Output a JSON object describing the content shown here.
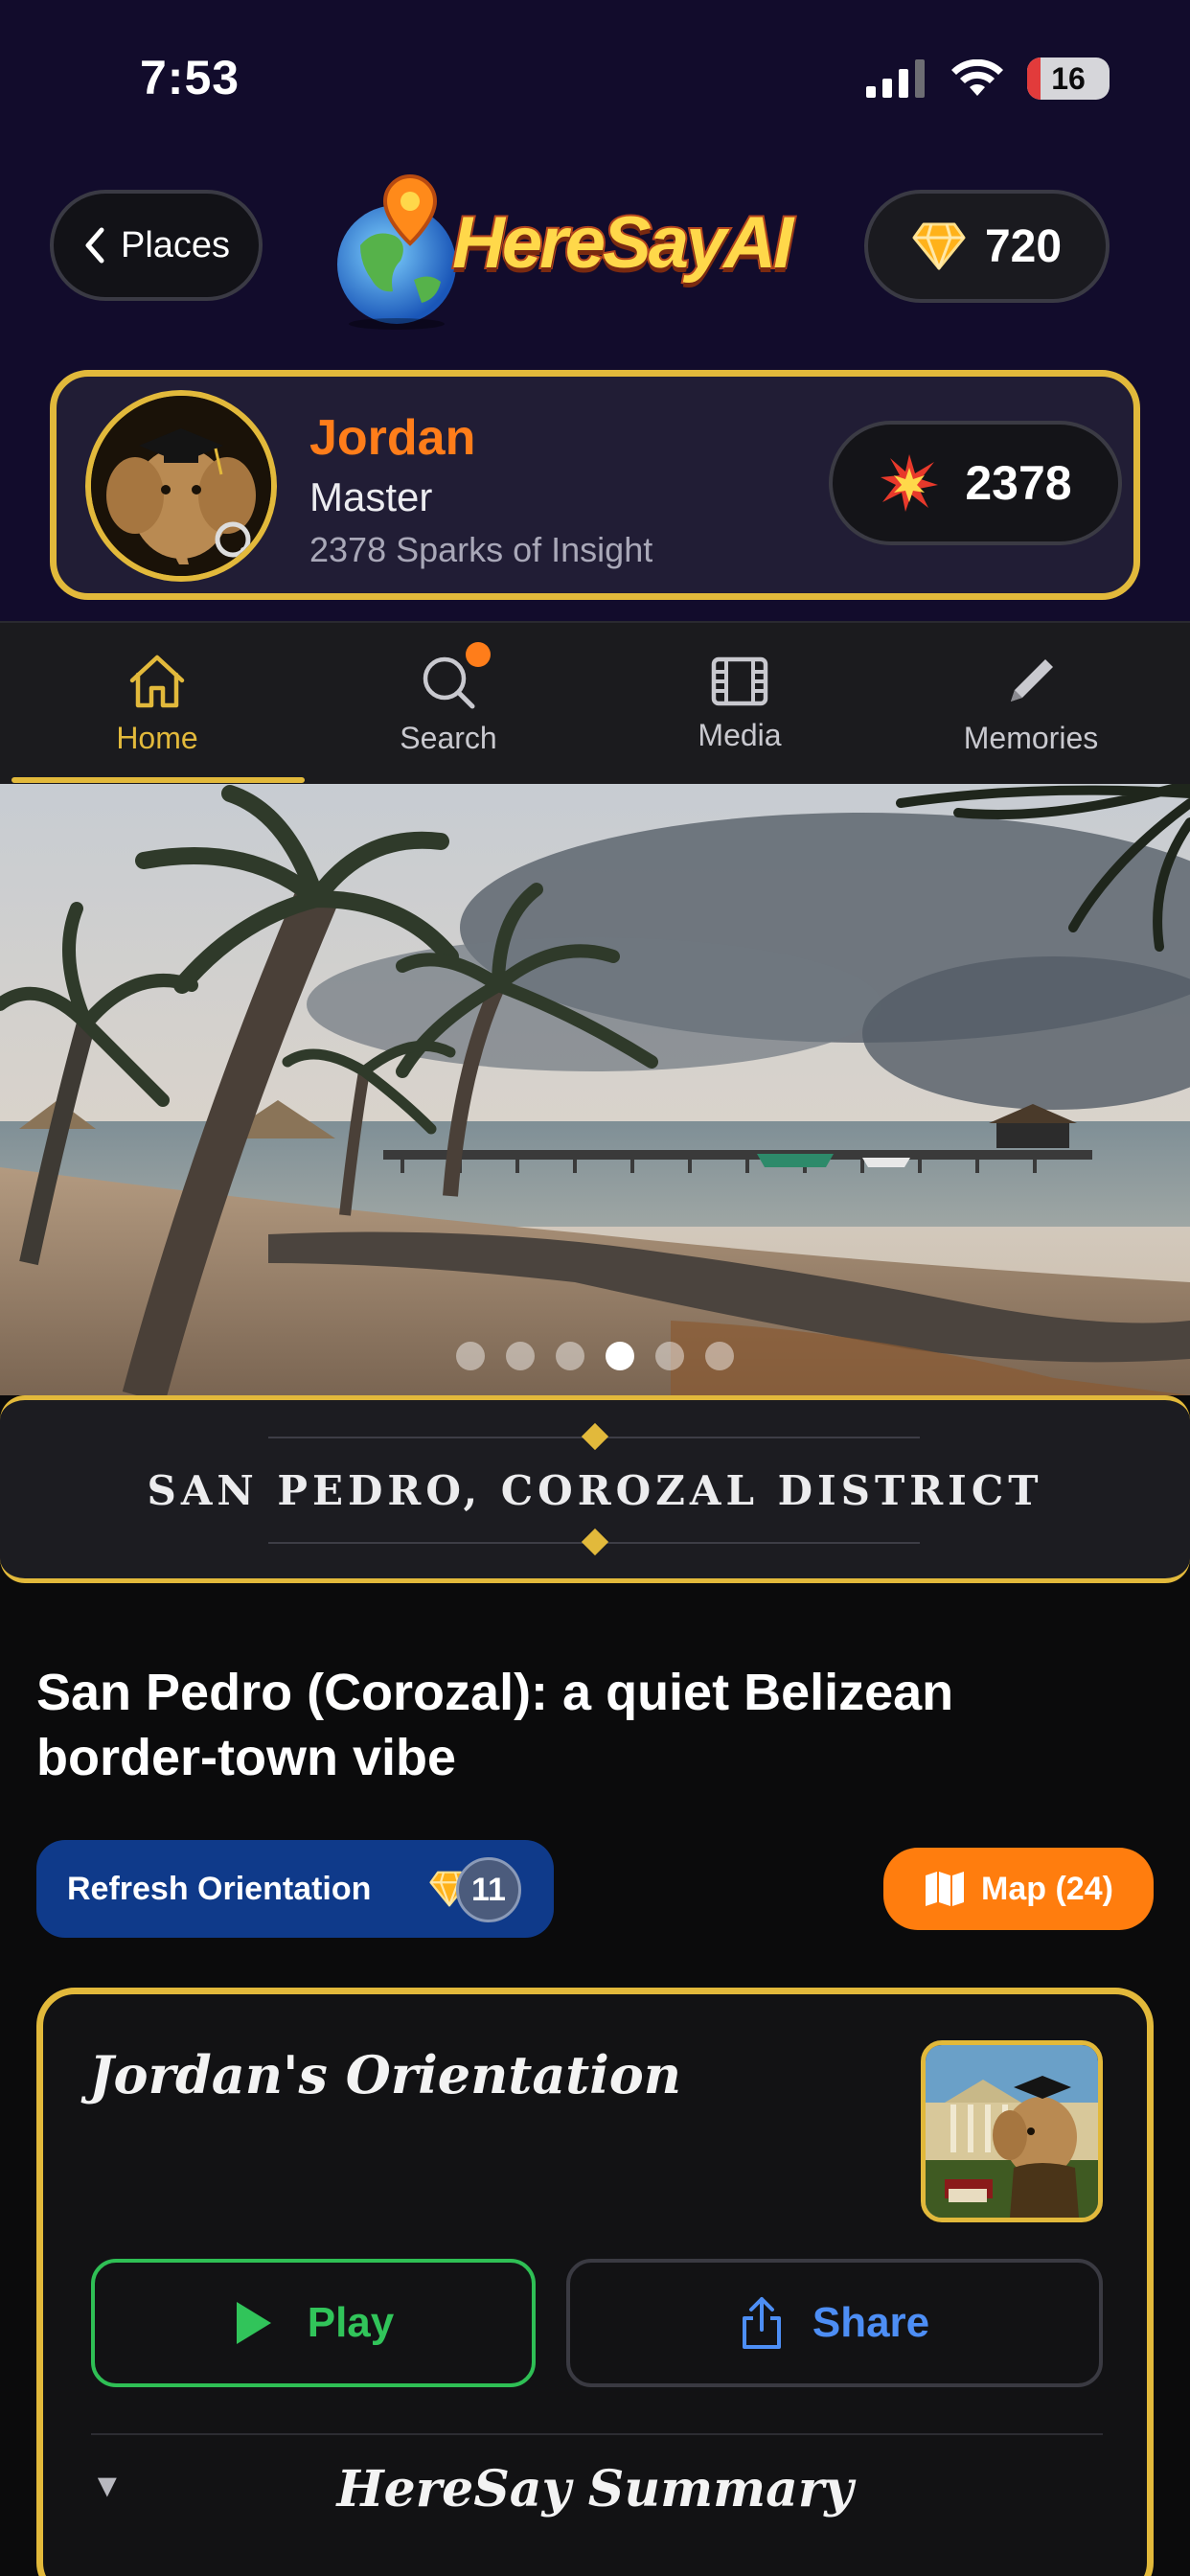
{
  "status_bar": {
    "time": "7:53",
    "battery": "16"
  },
  "header": {
    "back_label": "Places",
    "logo_text": "HereSayAI",
    "gems": "720"
  },
  "profile": {
    "name": "Jordan",
    "rank": "Master",
    "sparks_text": "2378 Sparks of Insight",
    "sparks": "2378"
  },
  "tabs": [
    {
      "label": "Home",
      "icon": "home-icon"
    },
    {
      "label": "Search",
      "icon": "search-icon"
    },
    {
      "label": "Media",
      "icon": "film-icon"
    },
    {
      "label": "Memories",
      "icon": "pencil-icon"
    }
  ],
  "carousel": {
    "count": 6,
    "active": 4
  },
  "location": {
    "banner": "SAN PEDRO, COROZAL DISTRICT"
  },
  "article": {
    "headline": "San Pedro (Corozal): a quiet Belizean border-town vibe",
    "refresh_label": "Refresh Orientation",
    "refresh_cost": "11",
    "map_label": "Map (24)"
  },
  "orientation": {
    "title": "Jordan's Orientation",
    "play_label": "Play",
    "share_label": "Share",
    "summary_title": "HereSay Summary"
  },
  "colors": {
    "accent_gold": "#e2b93b",
    "accent_orange": "#ff7d1a",
    "play_green": "#31c45a",
    "share_blue": "#4d8ef5",
    "header_bg": "#120c2c"
  }
}
